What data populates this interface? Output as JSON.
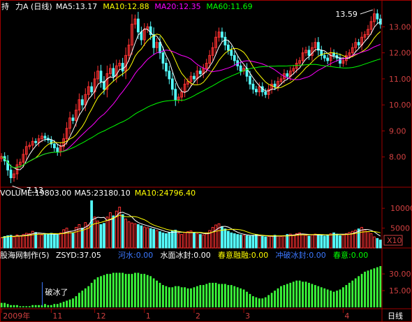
{
  "chart_data": [
    {
      "type": "candlestick",
      "title": "力A (日线)",
      "title_prefix": "持",
      "legend": [
        {
          "name": "MA5",
          "value": "13.17",
          "color": "#ffffff"
        },
        {
          "name": "MA10",
          "value": "12.88",
          "color": "#ffff00"
        },
        {
          "name": "MA20",
          "value": "12.35",
          "color": "#ff00ff"
        },
        {
          "name": "MA60",
          "value": "11.69",
          "color": "#00ff00"
        }
      ],
      "ylim": [
        7.0,
        13.6
      ],
      "yticks": [
        "13.00",
        "12.00",
        "11.00",
        "10.00",
        "9.00",
        "8.00"
      ],
      "annotations": {
        "high": "13.59",
        "low": "7.13"
      },
      "up_color": "#ff3232",
      "down_color": "#54fcfc",
      "close": [
        8.02,
        7.85,
        7.5,
        7.2,
        7.35,
        7.7,
        7.8,
        8.1,
        8.4,
        8.45,
        8.6,
        8.55,
        8.7,
        8.8,
        8.72,
        8.65,
        8.5,
        8.35,
        8.2,
        8.4,
        8.7,
        9.1,
        9.5,
        9.4,
        9.8,
        10.2,
        10.0,
        10.4,
        10.7,
        10.5,
        11.0,
        11.3,
        10.9,
        10.6,
        11.2,
        11.4,
        11.1,
        11.5,
        11.6,
        11.3,
        11.9,
        12.3,
        13.1,
        13.3,
        12.8,
        12.5,
        12.9,
        13.0,
        12.7,
        12.2,
        12.4,
        12.0,
        11.6,
        11.3,
        11.0,
        10.6,
        10.2,
        10.3,
        10.5,
        10.8,
        10.9,
        11.1,
        11.0,
        11.3,
        11.2,
        11.4,
        11.6,
        11.9,
        12.2,
        12.6,
        12.8,
        12.6,
        12.3,
        12.1,
        11.9,
        11.7,
        11.5,
        11.3,
        11.4,
        11.1,
        10.8,
        10.6,
        10.5,
        10.7,
        10.5,
        10.4,
        10.6,
        10.8,
        10.7,
        10.9,
        11.0,
        11.2,
        11.1,
        11.3,
        11.4,
        11.6,
        11.7,
        12.0,
        12.1,
        11.9,
        12.2,
        12.4,
        12.1,
        11.9,
        11.8,
        11.7,
        12.0,
        11.9,
        11.8,
        11.6,
        11.7,
        11.9,
        12.0,
        12.2,
        12.4,
        12.3,
        12.6,
        12.7,
        12.9,
        13.2,
        13.5,
        13.3,
        13.1
      ]
    },
    {
      "type": "bar",
      "title": "VOLUME",
      "legend": [
        {
          "name": "VOLUME",
          "value": "19803.00",
          "color": "#ffffff"
        },
        {
          "name": "MA5",
          "value": "23180.10",
          "color": "#ffffff"
        },
        {
          "name": "MA10",
          "value": "24796.40",
          "color": "#ffff00"
        }
      ],
      "ylim": [
        0,
        12500
      ],
      "yticks": [
        "10000",
        "5000"
      ],
      "unit": "X10",
      "values": [
        2600,
        2900,
        3100,
        3200,
        2800,
        3300,
        3000,
        3400,
        3700,
        3600,
        4200,
        3900,
        3500,
        3300,
        3400,
        3600,
        3700,
        3400,
        3300,
        3800,
        4600,
        5000,
        4200,
        3700,
        5200,
        5900,
        5000,
        6400,
        5800,
        11900,
        7800,
        6800,
        5900,
        6200,
        7800,
        8900,
        8100,
        9300,
        10300,
        8400,
        7300,
        6600,
        6300,
        6100,
        5900,
        5600,
        5300,
        5100,
        4900,
        4700,
        4400,
        4100,
        3800,
        3600,
        3900,
        4300,
        4500,
        3700,
        3400,
        3900,
        4100,
        4300,
        3800,
        3600,
        3400,
        3300,
        3800,
        4400,
        5200,
        5800,
        6100,
        5400,
        4800,
        4200,
        3800,
        3600,
        3400,
        3300,
        3200,
        3100,
        3000,
        3200,
        3400,
        3100,
        2900,
        2800,
        2900,
        3100,
        3200,
        3000,
        2900,
        3100,
        3400,
        3500,
        3300,
        3600,
        3800,
        3500,
        3200,
        3000,
        3300,
        3500,
        3400,
        3200,
        3000,
        3300,
        3600,
        3800,
        3500,
        3100,
        3300,
        3600,
        3900,
        4200,
        4500,
        4800,
        5200,
        4600,
        4100,
        3600,
        2800,
        2400,
        2000
      ]
    },
    {
      "type": "bar",
      "title": "股海网制作(5)",
      "legend": [
        {
          "name": "ZSYD",
          "value": "37.05",
          "color": "#ffffff"
        },
        {
          "name": "河水",
          "value": "0.00",
          "color": "#3c78ff"
        },
        {
          "name": "水面冰封",
          "value": "0.00",
          "color": "#ffffff"
        },
        {
          "name": "春意融融",
          "value": "0.00",
          "color": "#ffff00"
        },
        {
          "name": "冲破冰封",
          "value": "0.00",
          "color": "#3c78ff"
        },
        {
          "name": "春意",
          "value": "0.00",
          "color": "#00ff00"
        }
      ],
      "ylim": [
        0,
        42
      ],
      "yticks": [
        "30.00",
        "15.00"
      ],
      "annotation": "破冰了",
      "values": [
        4,
        4,
        3,
        2,
        2,
        2,
        1,
        1,
        1,
        1,
        2,
        2,
        2,
        2,
        3,
        2,
        2,
        3,
        3,
        4,
        5,
        6,
        7,
        8,
        10,
        13,
        15,
        17,
        19,
        22,
        25,
        27,
        28,
        29,
        30,
        30,
        31,
        31,
        31,
        31,
        30,
        30,
        30,
        31,
        31,
        30,
        30,
        29,
        28,
        26,
        24,
        22,
        20,
        19,
        18,
        18,
        19,
        19,
        18,
        18,
        17,
        17,
        18,
        19,
        20,
        20,
        21,
        22,
        22,
        22,
        21,
        21,
        21,
        20,
        20,
        19,
        18,
        17,
        16,
        14,
        12,
        10,
        9,
        8,
        8,
        9,
        11,
        13,
        15,
        17,
        19,
        20,
        21,
        22,
        23,
        24,
        24,
        23,
        23,
        22,
        21,
        20,
        19,
        18,
        17,
        16,
        15,
        14,
        15,
        16,
        18,
        20,
        22,
        24,
        26,
        28,
        30,
        32,
        33,
        34,
        35,
        36,
        37
      ]
    }
  ],
  "x_axis": {
    "labels": [
      "2009年",
      "11",
      "12",
      "1",
      "2",
      "3",
      "4"
    ],
    "period_label": "日线"
  }
}
